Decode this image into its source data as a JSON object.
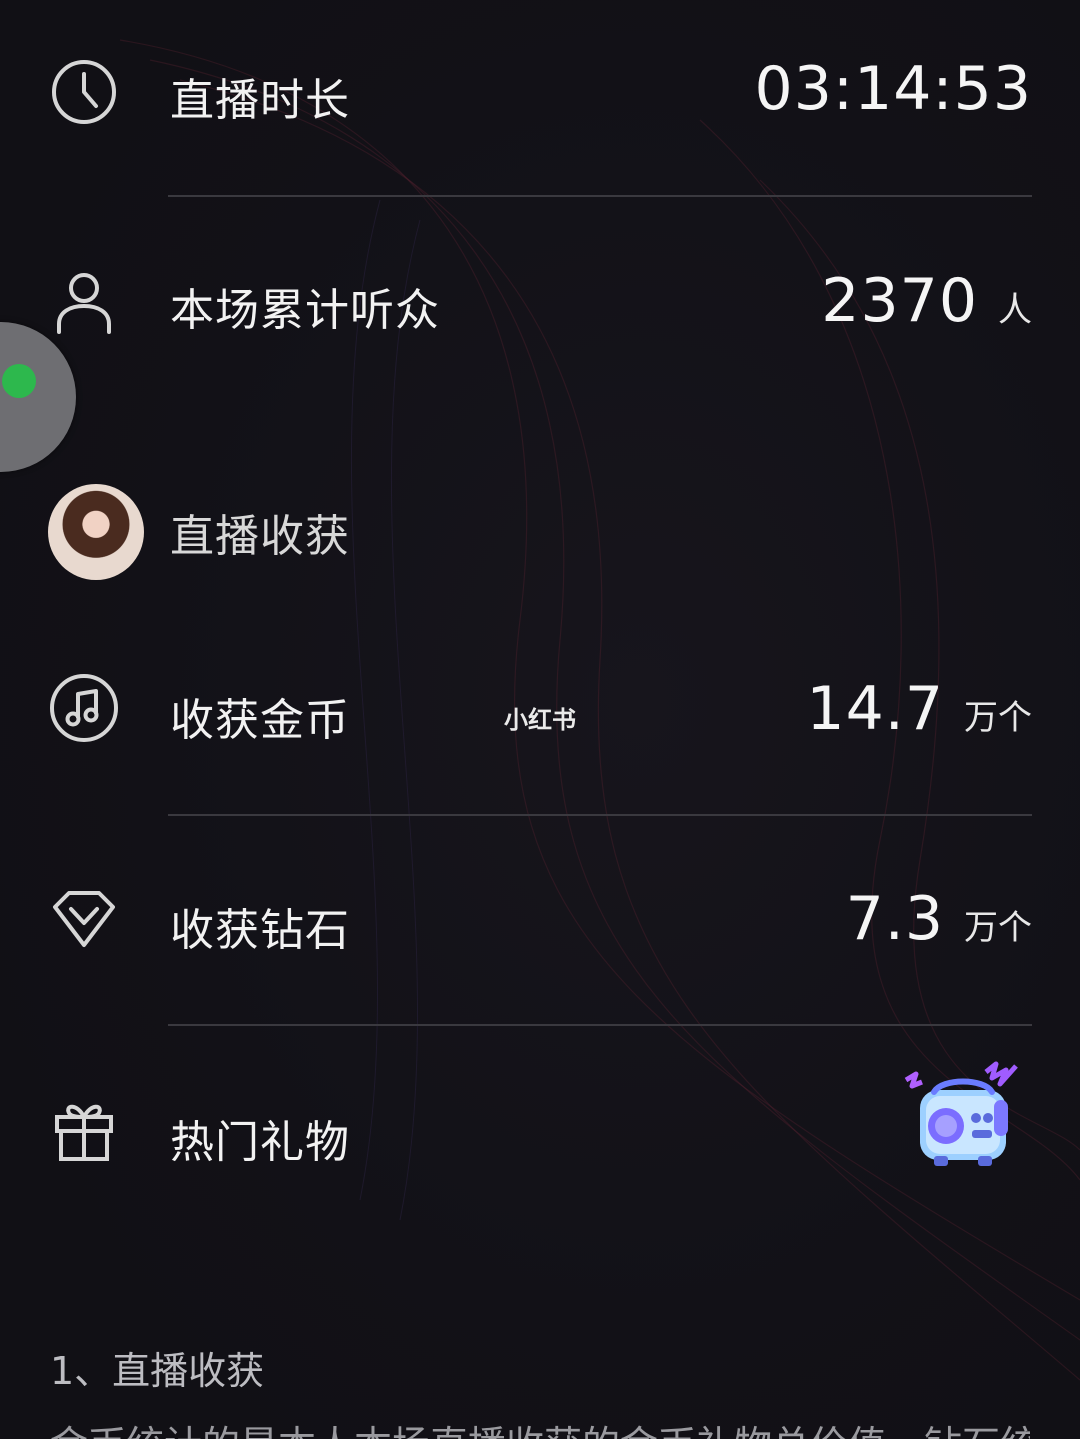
{
  "stats": [
    {
      "label": "直播时长",
      "value": "03:14:53",
      "unit": "",
      "icon": "clock-icon"
    },
    {
      "label": "本场累计听众",
      "value": "2370",
      "unit": "人",
      "icon": "user-icon"
    }
  ],
  "earnings_section": {
    "title": "直播收获",
    "coins": {
      "label": "收获金币",
      "value": "14.7",
      "unit": "万个",
      "icon": "music-note-icon"
    },
    "diamonds": {
      "label": "收获钻石",
      "value": "7.3",
      "unit": "万个",
      "icon": "diamond-icon"
    },
    "gifts": {
      "label": "热门礼物",
      "icon": "gift-icon",
      "gift_item": "radio-gift-icon"
    }
  },
  "watermark": "小红书",
  "notes": {
    "title": "1、直播收获",
    "body": "金币统计的是本人本场直播收获的金币礼物总价值，钻石统计"
  },
  "colors": {
    "background": "#121117",
    "divider": "#3a393f",
    "text_primary": "#f2f2f2",
    "text_secondary": "#9a9a9f",
    "float_button": "#6e6e72",
    "wechat_green": "#2db84d"
  }
}
